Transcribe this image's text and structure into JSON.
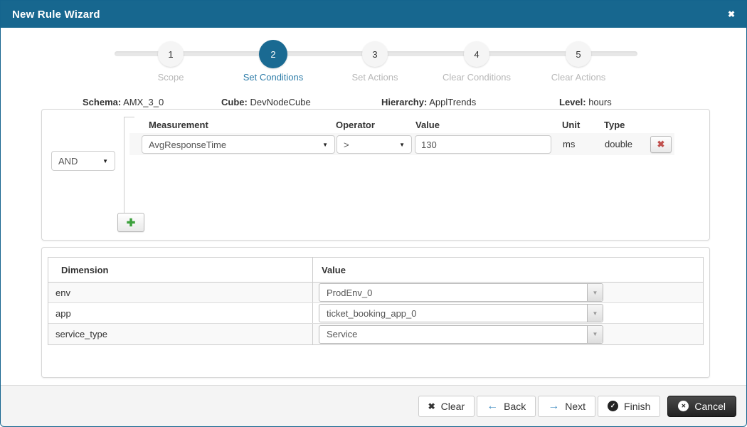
{
  "window": {
    "title": "New Rule Wizard"
  },
  "icons": {
    "close": "✖",
    "caret_down": "▼",
    "combo_caret": "▼",
    "clear_x": "✖",
    "back_arrow": "←",
    "next_arrow": "→",
    "finish_check": "✓",
    "cancel_x": "✕",
    "delete_x": "✖",
    "add_plus": "✚"
  },
  "stepper": {
    "active_step": 2,
    "steps": [
      {
        "num": "1",
        "label": "Scope"
      },
      {
        "num": "2",
        "label": "Set Conditions"
      },
      {
        "num": "3",
        "label": "Set Actions"
      },
      {
        "num": "4",
        "label": "Clear Conditions"
      },
      {
        "num": "5",
        "label": "Clear Actions"
      }
    ]
  },
  "context": {
    "items": [
      {
        "label": "Schema:",
        "value": "AMX_3_0"
      },
      {
        "label": "Cube:",
        "value": "DevNodeCube"
      },
      {
        "label": "Hierarchy:",
        "value": "ApplTrends"
      },
      {
        "label": "Level:",
        "value": "hours"
      }
    ]
  },
  "conditions": {
    "logic_operator": "AND",
    "columns": {
      "measurement": "Measurement",
      "operator": "Operator",
      "value": "Value",
      "unit": "Unit",
      "type": "Type"
    },
    "rows": [
      {
        "measurement": "AvgResponseTime",
        "operator": ">",
        "value": "130",
        "unit": "ms",
        "type": "double"
      }
    ]
  },
  "dimensions": {
    "columns": {
      "dimension": "Dimension",
      "value": "Value"
    },
    "rows": [
      {
        "dimension": "env",
        "value": "ProdEnv_0"
      },
      {
        "dimension": "app",
        "value": "ticket_booking_app_0"
      },
      {
        "dimension": "service_type",
        "value": "Service"
      }
    ]
  },
  "footer": {
    "clear": "Clear",
    "back": "Back",
    "next": "Next",
    "finish": "Finish",
    "cancel": "Cancel"
  },
  "colors": {
    "header_bg": "#17678f",
    "active_step_bg": "#1a6a92",
    "active_step_label": "#2d7ca8",
    "accent_blue": "#4a92c4",
    "delete_red": "#c0504d",
    "add_green": "#3da03d",
    "footer_bg": "#f4f4f4"
  }
}
